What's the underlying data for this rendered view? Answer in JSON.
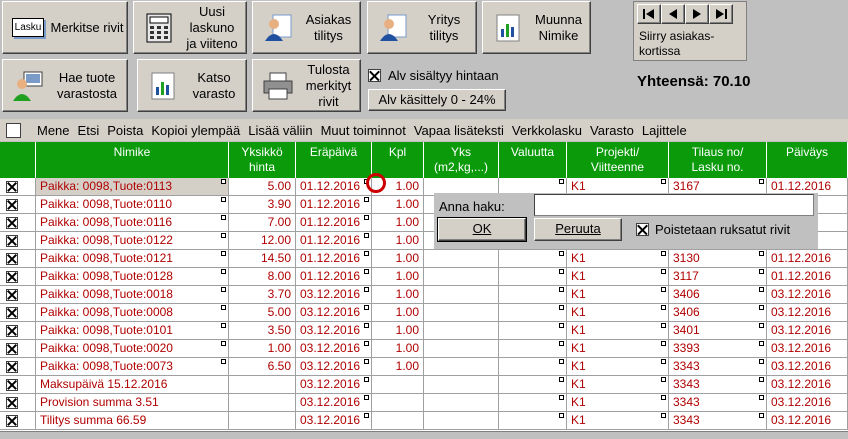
{
  "toolbar": {
    "merkitse": {
      "icon_text": "Lasku",
      "label": "Merkitse rivit"
    },
    "uusi": {
      "label": "Uusi\nlaskuno\nja viiteno"
    },
    "asiakas": {
      "label": "Asiakas\ntilitys"
    },
    "yritys": {
      "label": "Yritys\ntilitys"
    },
    "muunna": {
      "label": "Muunna\nNimike"
    },
    "hae": {
      "label": "Hae tuote\nvarastosta"
    },
    "katso": {
      "label": "Katso\nvarasto"
    },
    "tulosta": {
      "label": "Tulosta\nmerkityt\nrivit"
    },
    "alv_checkbox_label": "Alv sisältyy hintaan",
    "alv_checked": true,
    "alv_kasittely": "Alv käsittely 0 - 24%"
  },
  "nav": {
    "label": "Siirry asiakas-\nkortissa",
    "buttons": [
      "first-record",
      "previous-record",
      "next-record",
      "last-record"
    ]
  },
  "total": {
    "label": "Yhteensä:",
    "value": "70.10"
  },
  "menu": {
    "items": [
      "Mene",
      "Etsi",
      "Poista",
      "Kopioi ylempää",
      "Lisää väliin",
      "Muut toiminnot",
      "Vapaa lisäteksti",
      "Verkkolasku",
      "Varasto",
      "Lajittele"
    ]
  },
  "table": {
    "headers": [
      "Nimike",
      "Yksikkö\nhinta",
      "Eräpäivä",
      "Kpl",
      "Yks\n(m2,kg,...)",
      "Valuutta",
      "Projekti/\nViitteenne",
      "Tilaus no/\nLasku no.",
      "Päiväys"
    ],
    "rows": [
      {
        "nimike": "Paikka: 0098,Tuote:0113",
        "hinta": "5.00",
        "erapaiva": "01.12.2016",
        "kpl": "1.00",
        "projekti": "K1",
        "tilaus": "3167",
        "paivays": "01.12.2016"
      },
      {
        "nimike": "Paikka: 0098,Tuote:0110",
        "hinta": "3.90",
        "erapaiva": "01.12.2016",
        "kpl": "1.00",
        "projekti": "",
        "tilaus": "",
        "paivays": "016"
      },
      {
        "nimike": "Paikka: 0098,Tuote:0116",
        "hinta": "7.00",
        "erapaiva": "01.12.2016",
        "kpl": "1.00",
        "projekti": "",
        "tilaus": "",
        "paivays": "016"
      },
      {
        "nimike": "Paikka: 0098,Tuote:0122",
        "hinta": "12.00",
        "erapaiva": "01.12.2016",
        "kpl": "1.00",
        "projekti": "",
        "tilaus": "",
        "paivays": "016"
      },
      {
        "nimike": "Paikka: 0098,Tuote:0121",
        "hinta": "14.50",
        "erapaiva": "01.12.2016",
        "kpl": "1.00",
        "projekti": "K1",
        "tilaus": "3130",
        "paivays": "01.12.2016"
      },
      {
        "nimike": "Paikka: 0098,Tuote:0128",
        "hinta": "8.00",
        "erapaiva": "01.12.2016",
        "kpl": "1.00",
        "projekti": "K1",
        "tilaus": "3117",
        "paivays": "01.12.2016"
      },
      {
        "nimike": "Paikka: 0098,Tuote:0018",
        "hinta": "3.70",
        "erapaiva": "03.12.2016",
        "kpl": "1.00",
        "projekti": "K1",
        "tilaus": "3406",
        "paivays": "03.12.2016"
      },
      {
        "nimike": "Paikka: 0098,Tuote:0008",
        "hinta": "5.00",
        "erapaiva": "03.12.2016",
        "kpl": "1.00",
        "projekti": "K1",
        "tilaus": "3406",
        "paivays": "03.12.2016"
      },
      {
        "nimike": "Paikka: 0098,Tuote:0101",
        "hinta": "3.50",
        "erapaiva": "03.12.2016",
        "kpl": "1.00",
        "projekti": "K1",
        "tilaus": "3401",
        "paivays": "03.12.2016"
      },
      {
        "nimike": "Paikka: 0098,Tuote:0020",
        "hinta": "1.00",
        "erapaiva": "03.12.2016",
        "kpl": "1.00",
        "projekti": "K1",
        "tilaus": "3393",
        "paivays": "03.12.2016"
      },
      {
        "nimike": "Paikka: 0098,Tuote:0073",
        "hinta": "6.50",
        "erapaiva": "03.12.2016",
        "kpl": "1.00",
        "projekti": "K1",
        "tilaus": "3343",
        "paivays": "03.12.2016"
      },
      {
        "nimike": "Maksupäivä 15.12.2016",
        "hinta": "",
        "erapaiva": "03.12.2016",
        "kpl": "",
        "projekti": "K1",
        "tilaus": "3343",
        "paivays": "03.12.2016"
      },
      {
        "nimike": "Provision summa 3.51",
        "hinta": "",
        "erapaiva": "03.12.2016",
        "kpl": "",
        "projekti": "K1",
        "tilaus": "3343",
        "paivays": "03.12.2016"
      },
      {
        "nimike": "Tilitys summa 66.59",
        "hinta": "",
        "erapaiva": "03.12.2016",
        "kpl": "",
        "projekti": "K1",
        "tilaus": "3343",
        "paivays": "03.12.2016"
      }
    ]
  },
  "popup": {
    "label": "Anna haku:",
    "value": "",
    "ok": "OK",
    "cancel": "Peruuta",
    "checkbox_label": "Poistetaan ruksatut rivit",
    "checked": true
  },
  "colors": {
    "header_green": "#0a9a0a",
    "cell_red": "#b00000",
    "highlight": "#cc0000"
  }
}
